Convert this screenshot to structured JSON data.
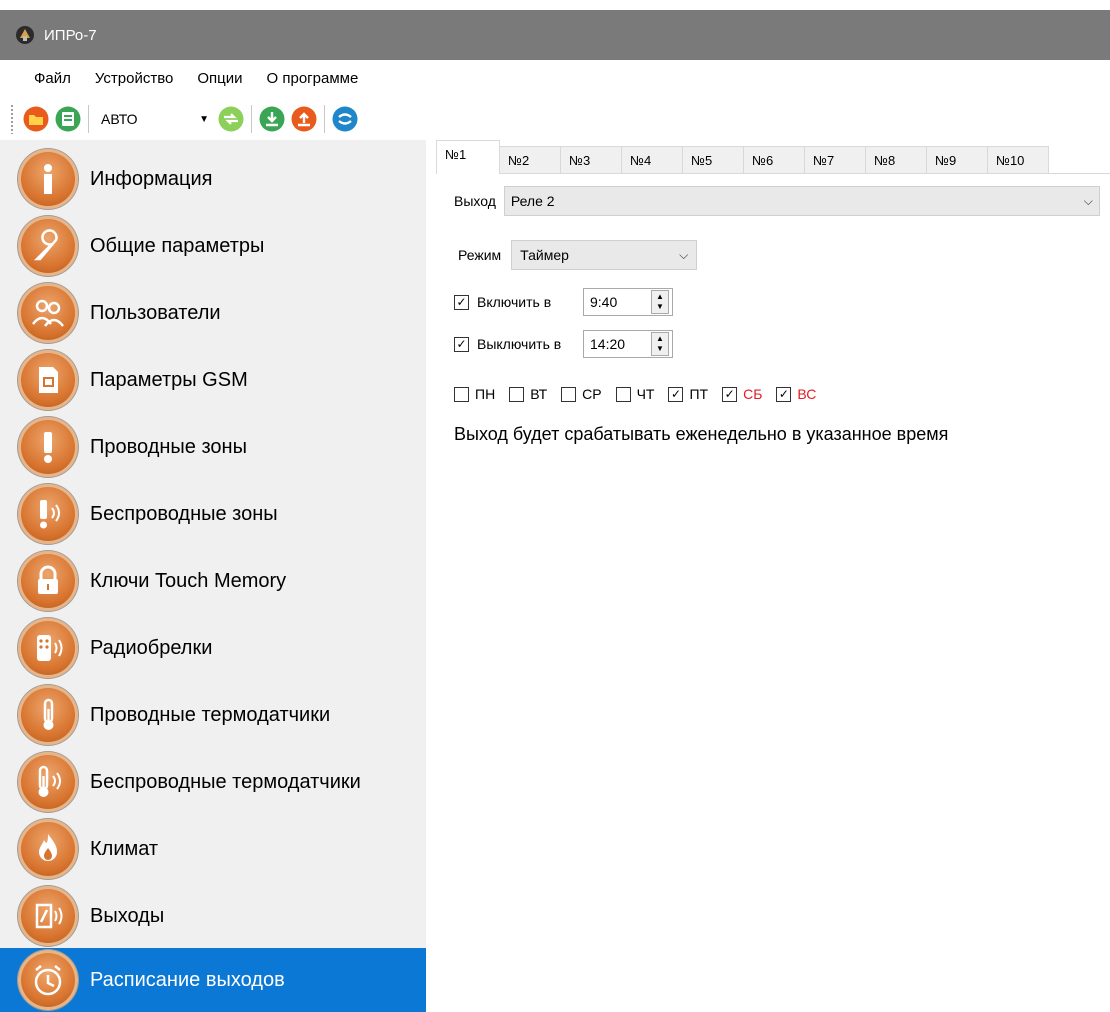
{
  "window": {
    "title": "ИПРо-7"
  },
  "menu": [
    "Файл",
    "Устройство",
    "Опции",
    "О программе"
  ],
  "toolbar": {
    "mode_value": "АВТО"
  },
  "sidebar": {
    "items": [
      {
        "label": "Информация"
      },
      {
        "label": "Общие параметры"
      },
      {
        "label": "Пользователи"
      },
      {
        "label": "Параметры GSM"
      },
      {
        "label": "Проводные зоны"
      },
      {
        "label": "Беспроводные зоны"
      },
      {
        "label": "Ключи Touch Memory"
      },
      {
        "label": "Радиобрелки"
      },
      {
        "label": "Проводные термодатчики"
      },
      {
        "label": "Беспроводные термодатчики"
      },
      {
        "label": "Климат"
      },
      {
        "label": "Выходы"
      },
      {
        "label": "Расписание выходов"
      }
    ],
    "active_index": 12
  },
  "tabs": [
    "№1",
    "№2",
    "№3",
    "№4",
    "№5",
    "№6",
    "№7",
    "№8",
    "№9",
    "№10"
  ],
  "active_tab": 0,
  "output": {
    "label": "Выход",
    "value": "Реле 2"
  },
  "mode": {
    "label": "Режим",
    "value": "Таймер"
  },
  "turn_on": {
    "label": "Включить в",
    "time": "9:40",
    "checked": true
  },
  "turn_off": {
    "label": "Выключить в",
    "time": "14:20",
    "checked": true
  },
  "days": [
    {
      "label": "ПН",
      "checked": false,
      "weekend": false
    },
    {
      "label": "ВТ",
      "checked": false,
      "weekend": false
    },
    {
      "label": "СР",
      "checked": false,
      "weekend": false
    },
    {
      "label": "ЧТ",
      "checked": false,
      "weekend": false
    },
    {
      "label": "ПТ",
      "checked": true,
      "weekend": false
    },
    {
      "label": "СБ",
      "checked": true,
      "weekend": true
    },
    {
      "label": "ВС",
      "checked": true,
      "weekend": true
    }
  ],
  "info_text": "Выход будет срабатывать еженедельно в указанное время",
  "colors": {
    "titlebar": "#7a7a7a",
    "sidebar": "#f0f0f0",
    "active": "#0a78d4",
    "icon_orange": "#d8742f",
    "weekend_red": "#e31b23"
  }
}
